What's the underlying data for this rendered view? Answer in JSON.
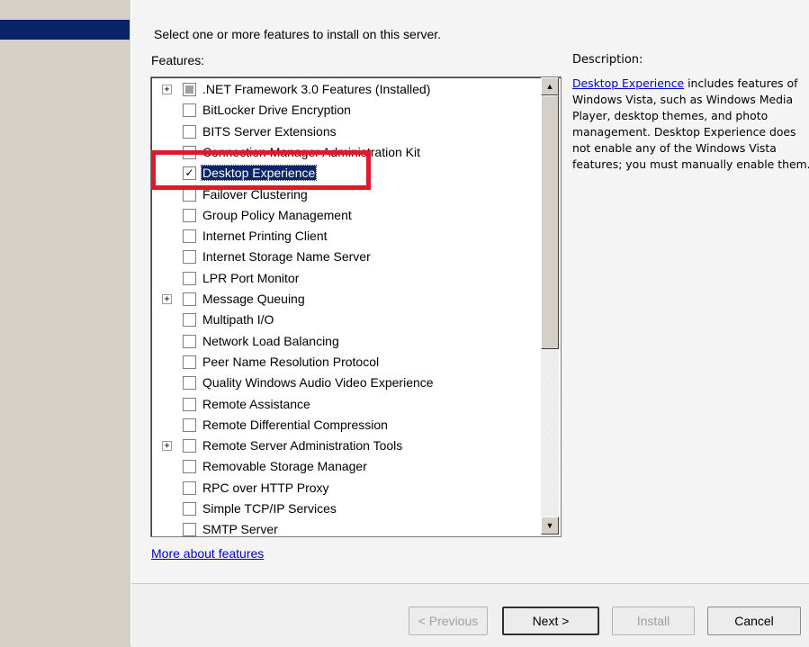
{
  "instruction": "Select one or more features to install on this server.",
  "features_label": "Features:",
  "description_label": "Description:",
  "features": [
    {
      "label": ".NET Framework 3.0 Features  (Installed)",
      "expandable": true,
      "state": "partial"
    },
    {
      "label": "BitLocker Drive Encryption",
      "expandable": false,
      "state": "unchecked"
    },
    {
      "label": "BITS Server Extensions",
      "expandable": false,
      "state": "unchecked"
    },
    {
      "label": "Connection Manager Administration Kit",
      "expandable": false,
      "state": "unchecked"
    },
    {
      "label": "Desktop Experience",
      "expandable": false,
      "state": "checked",
      "selected": true
    },
    {
      "label": "Failover Clustering",
      "expandable": false,
      "state": "unchecked"
    },
    {
      "label": "Group Policy Management",
      "expandable": false,
      "state": "unchecked"
    },
    {
      "label": "Internet Printing Client",
      "expandable": false,
      "state": "unchecked"
    },
    {
      "label": "Internet Storage Name Server",
      "expandable": false,
      "state": "unchecked"
    },
    {
      "label": "LPR Port Monitor",
      "expandable": false,
      "state": "unchecked"
    },
    {
      "label": "Message Queuing",
      "expandable": true,
      "state": "unchecked"
    },
    {
      "label": "Multipath I/O",
      "expandable": false,
      "state": "unchecked"
    },
    {
      "label": "Network Load Balancing",
      "expandable": false,
      "state": "unchecked"
    },
    {
      "label": "Peer Name Resolution Protocol",
      "expandable": false,
      "state": "unchecked"
    },
    {
      "label": "Quality Windows Audio Video Experience",
      "expandable": false,
      "state": "unchecked"
    },
    {
      "label": "Remote Assistance",
      "expandable": false,
      "state": "unchecked"
    },
    {
      "label": "Remote Differential Compression",
      "expandable": false,
      "state": "unchecked"
    },
    {
      "label": "Remote Server Administration Tools",
      "expandable": true,
      "state": "unchecked"
    },
    {
      "label": "Removable Storage Manager",
      "expandable": false,
      "state": "unchecked"
    },
    {
      "label": "RPC over HTTP Proxy",
      "expandable": false,
      "state": "unchecked"
    },
    {
      "label": "Simple TCP/IP Services",
      "expandable": false,
      "state": "unchecked"
    },
    {
      "label": "SMTP Server",
      "expandable": false,
      "state": "unchecked"
    }
  ],
  "description": {
    "link_text": "Desktop Experience",
    "text": " includes features of Windows Vista, such as Windows Media Player, desktop themes, and photo management. Desktop Experience does not enable any of the Windows Vista features; you must manually enable them."
  },
  "more_link": "More about features",
  "buttons": {
    "previous": "< Previous",
    "next": "Next >",
    "install": "Install",
    "cancel": "Cancel"
  },
  "colors": {
    "selection": "#0a246a",
    "annotation_box": "#e0192a",
    "link": "#0000cc"
  },
  "icons": {
    "expander": "plus-expander-icon",
    "scroll_up": "scroll-up-arrow-icon",
    "scroll_down": "scroll-down-arrow-icon",
    "check": "checkmark-icon"
  }
}
